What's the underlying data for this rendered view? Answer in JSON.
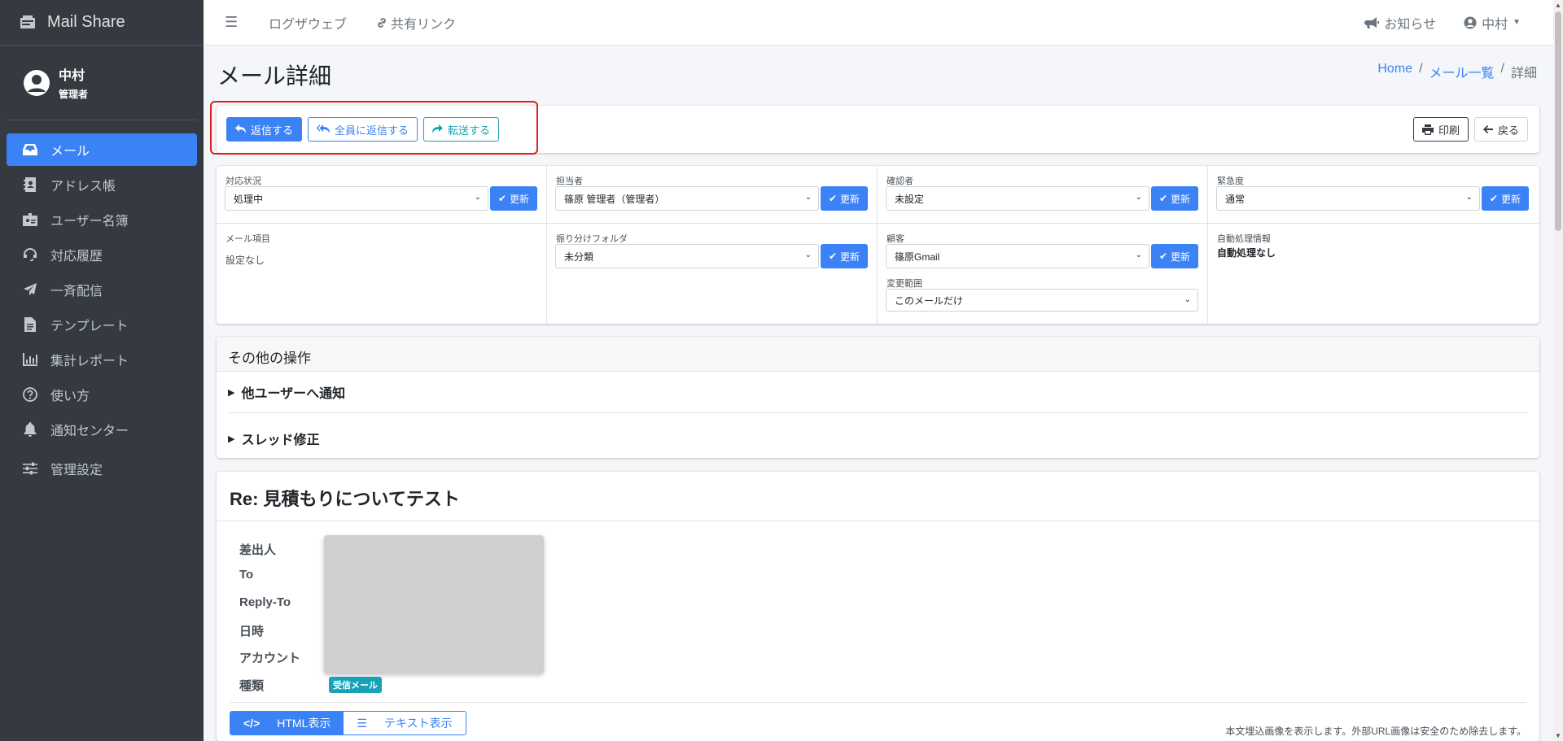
{
  "brand": {
    "name": "Mail Share"
  },
  "user": {
    "name": "中村",
    "role": "管理者"
  },
  "sidebar": {
    "items": [
      {
        "label": "メール"
      },
      {
        "label": "アドレス帳"
      },
      {
        "label": "ユーザー名簿"
      },
      {
        "label": "対応履歴"
      },
      {
        "label": "一斉配信"
      },
      {
        "label": "テンプレート"
      },
      {
        "label": "集計レポート"
      },
      {
        "label": "使い方"
      },
      {
        "label": "通知センター"
      },
      {
        "label": "管理設定"
      }
    ]
  },
  "topbar": {
    "links": [
      "ログザウェブ",
      "共有リンク"
    ],
    "notices": "お知らせ",
    "user": "中村"
  },
  "page": {
    "title": "メール詳細",
    "breadcrumb": [
      "Home",
      "メール一覧",
      "詳細"
    ]
  },
  "actions": {
    "reply": "返信する",
    "reply_all": "全員に返信する",
    "forward": "転送する",
    "print": "印刷",
    "back": "戻る"
  },
  "props": {
    "update_label": "更新",
    "status": {
      "label": "対応状況",
      "value": "処理中"
    },
    "assignee": {
      "label": "担当者",
      "value": "篠原 管理者（管理者）"
    },
    "confirmer": {
      "label": "確認者",
      "value": "未設定"
    },
    "urgency": {
      "label": "緊急度",
      "value": "通常"
    },
    "mail_item": {
      "label": "メール項目",
      "value": "設定なし"
    },
    "folder": {
      "label": "振り分けフォルダ",
      "value": "未分類"
    },
    "customer": {
      "label": "顧客",
      "value": "篠原Gmail"
    },
    "scope": {
      "label": "変更範囲",
      "value": "このメールだけ"
    },
    "auto": {
      "label": "自動処理情報",
      "value": "自動処理なし"
    }
  },
  "ops": {
    "header": "その他の操作",
    "notify": "他ユーザーへ通知",
    "thread": "スレッド修正"
  },
  "mail": {
    "subject": "Re: 見積もりについてテスト",
    "fields": [
      "差出人",
      "To",
      "Reply-To",
      "日時",
      "アカウント",
      "種類"
    ],
    "type_badge": "受信メール",
    "view_html": "HTML表示",
    "view_text": "テキスト表示",
    "note": "本文埋込画像を表示します。外部URL画像は安全のため除去します。"
  },
  "colors": {
    "primary": "#3b82f6",
    "sidebar": "#343a40",
    "info": "#17a2b8",
    "highlight": "#e11d1d"
  }
}
